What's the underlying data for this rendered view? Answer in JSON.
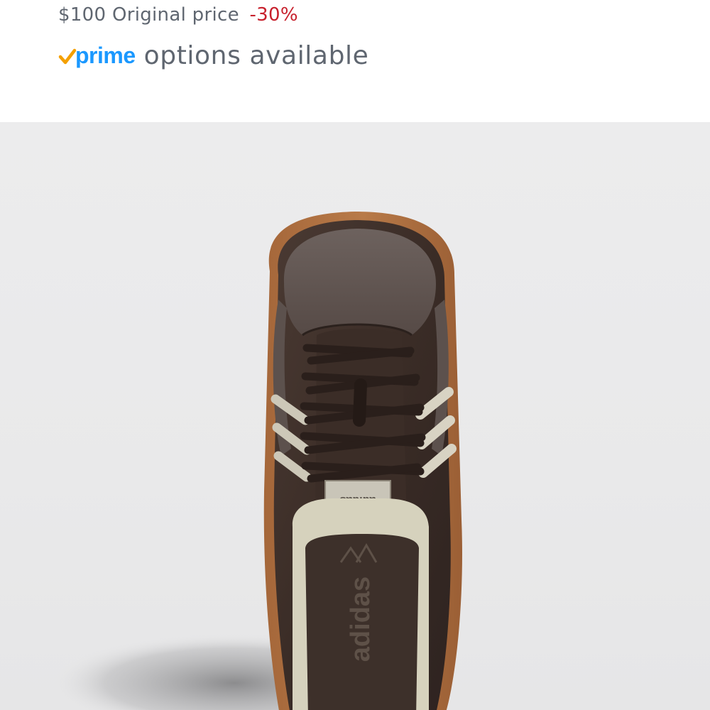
{
  "pricing": {
    "original_price": "$100",
    "original_price_label": "Original price",
    "discount": "-30%"
  },
  "prime": {
    "logo_word": "prime",
    "options_text": "options available"
  },
  "product": {
    "image_icon": "sneaker-image",
    "brand_marks": {
      "tongue_label": "adidas",
      "insole_label": "adidas"
    }
  },
  "colors": {
    "price_text": "#5f6670",
    "discount": "#c7202c",
    "prime_blue": "#1a98ff",
    "prime_check": "#f4a000",
    "image_background": "#ececed"
  }
}
